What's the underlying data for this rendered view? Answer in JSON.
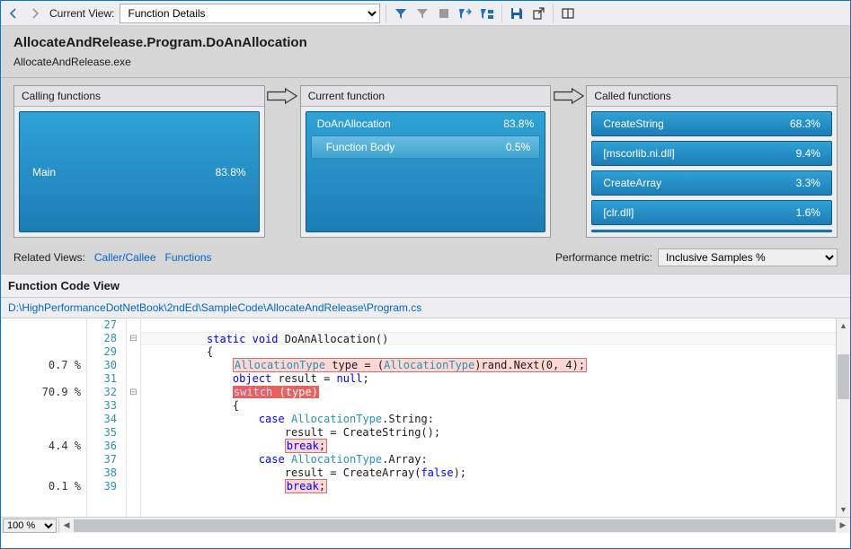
{
  "toolbar": {
    "current_view_label": "Current View:",
    "current_view_value": "Function Details"
  },
  "header": {
    "title": "AllocateAndRelease.Program.DoAnAllocation",
    "subtitle": "AllocateAndRelease.exe"
  },
  "panels": {
    "calling": {
      "title": "Calling functions",
      "items": [
        {
          "name": "Main",
          "pct": "83.8%"
        }
      ]
    },
    "current": {
      "title": "Current function",
      "name": "DoAnAllocation",
      "pct": "83.8%",
      "body_label": "Function Body",
      "body_pct": "0.5%"
    },
    "called": {
      "title": "Called functions",
      "items": [
        {
          "name": "CreateString",
          "pct": "68.3%"
        },
        {
          "name": "[mscorlib.ni.dll]",
          "pct": "9.4%"
        },
        {
          "name": "CreateArray",
          "pct": "3.3%"
        },
        {
          "name": "[clr.dll]",
          "pct": "1.6%"
        }
      ]
    }
  },
  "meta": {
    "related_label": "Related Views:",
    "link_caller_callee": "Caller/Callee",
    "link_functions": "Functions",
    "perf_metric_label": "Performance metric:",
    "perf_metric_value": "Inclusive Samples %"
  },
  "code_view": {
    "title": "Function Code View",
    "path": "D:\\HighPerformanceDotNetBook\\2ndEd\\SampleCode\\AllocateAndRelease\\Program.cs",
    "lines": [
      {
        "n": 27,
        "pct": "",
        "text": ""
      },
      {
        "n": 28,
        "pct": "",
        "fold": "⊟",
        "text_html": "         <span class='kw'>static</span> <span class='kw'>void</span> DoAnAllocation()",
        "cursor": true
      },
      {
        "n": 29,
        "pct": "",
        "text": "         {"
      },
      {
        "n": 30,
        "pct": "0.7 %",
        "text_html": "             <span class='hl-light'><span class='type'>AllocationType</span> type = (<span class='type'>AllocationType</span>)rand.Next(0, 4);</span>"
      },
      {
        "n": 31,
        "pct": "",
        "text_html": "             <span class='kw'>object</span> result = <span class='kw'>null</span>;"
      },
      {
        "n": 32,
        "pct": "70.9 %",
        "fold": "⊟",
        "text_html": "             <span class='hl-red'><span style='color:#c0e0ff'>switch</span> (type)</span>"
      },
      {
        "n": 33,
        "pct": "",
        "text": "             {"
      },
      {
        "n": 34,
        "pct": "",
        "text_html": "                 <span class='kw'>case</span> <span class='type'>AllocationType</span>.String:"
      },
      {
        "n": 35,
        "pct": "",
        "text": "                     result = CreateString();"
      },
      {
        "n": 36,
        "pct": "4.4 %",
        "text_html": "                     <span class='hl-light'><span class='kw'>break</span>;</span>"
      },
      {
        "n": 37,
        "pct": "",
        "text_html": "                 <span class='kw'>case</span> <span class='type'>AllocationType</span>.Array:"
      },
      {
        "n": 38,
        "pct": "",
        "text_html": "                     result = CreateArray(<span class='kw'>false</span>);"
      },
      {
        "n": 39,
        "pct": "0.1 %",
        "text_html": "                     <span class='hl-light'><span class='kw'>break</span>;</span>"
      }
    ]
  },
  "zoom": "100 %"
}
